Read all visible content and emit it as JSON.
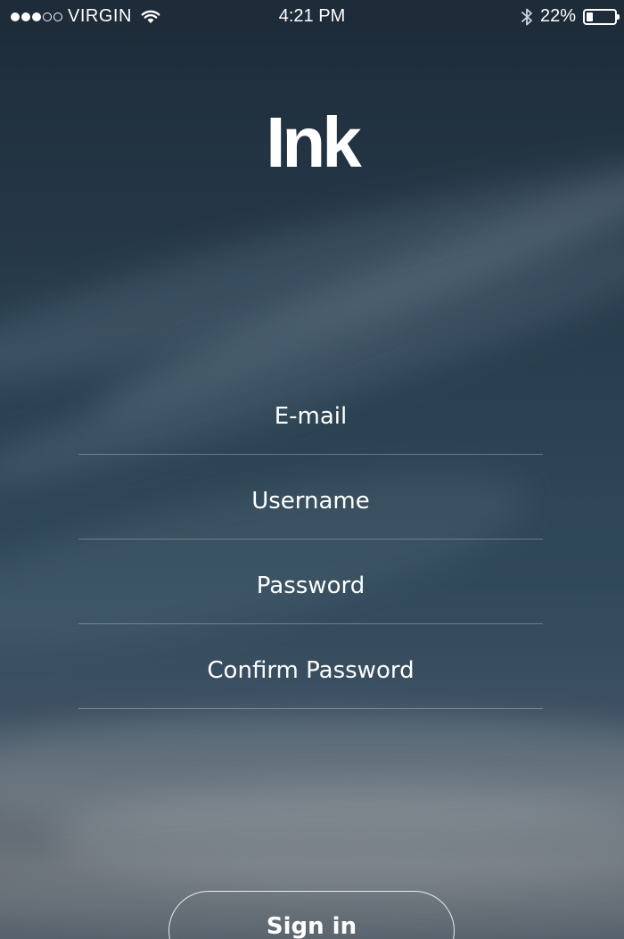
{
  "status_bar": {
    "signal_dots": [
      true,
      true,
      true,
      false,
      false
    ],
    "carrier": "VIRGIN",
    "time": "4:21 PM",
    "battery": "22%",
    "battery_level": 0.22,
    "icons": [
      "signal-icon",
      "wifi-icon",
      "bluetooth-icon",
      "battery-icon"
    ]
  },
  "app": {
    "logo": "Ink"
  },
  "form": {
    "fields": [
      {
        "placeholder": "E-mail",
        "value": ""
      },
      {
        "placeholder": "Username",
        "value": ""
      },
      {
        "placeholder": "Password",
        "value": ""
      },
      {
        "placeholder": "Confirm Password",
        "value": ""
      }
    ],
    "signin_label": "Sign in"
  },
  "colors": {
    "text": "#ffffff",
    "background_top": "#1d2b38",
    "background_bottom": "#6b727a"
  }
}
